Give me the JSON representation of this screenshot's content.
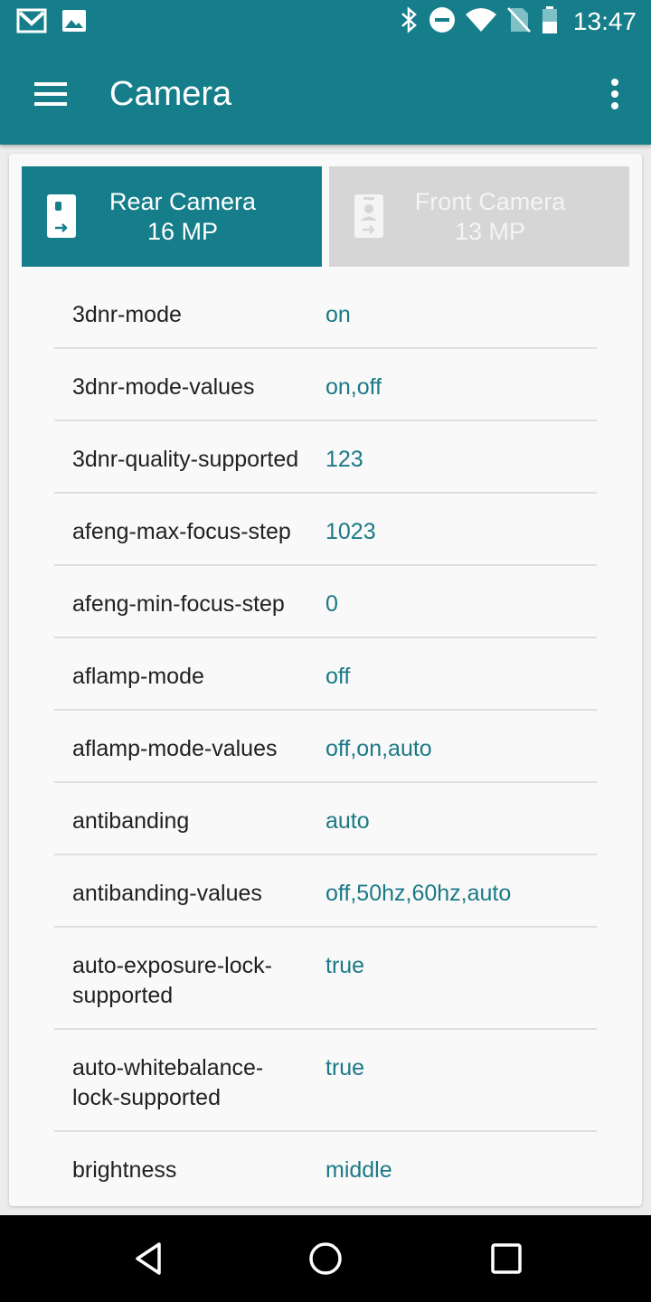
{
  "status_bar": {
    "time": "13:47",
    "left_icons": [
      "gmail-icon",
      "image-icon"
    ],
    "right_icons": [
      "bluetooth-icon",
      "do-not-disturb-icon",
      "wifi-icon",
      "no-sim-icon",
      "battery-icon"
    ]
  },
  "app_bar": {
    "title": "Camera",
    "menu_icon": "hamburger-menu-icon",
    "overflow_icon": "more-vert-icon"
  },
  "tabs": [
    {
      "label": "Rear Camera",
      "sub": "16 MP",
      "selected": true,
      "icon": "rear-camera-icon"
    },
    {
      "label": "Front Camera",
      "sub": "13 MP",
      "selected": false,
      "icon": "front-camera-icon"
    }
  ],
  "params": [
    {
      "key": "3dnr-mode",
      "value": "on"
    },
    {
      "key": "3dnr-mode-values",
      "value": "on,off"
    },
    {
      "key": "3dnr-quality-supported",
      "value": "123"
    },
    {
      "key": "afeng-max-focus-step",
      "value": "1023"
    },
    {
      "key": "afeng-min-focus-step",
      "value": "0"
    },
    {
      "key": "aflamp-mode",
      "value": "off"
    },
    {
      "key": "aflamp-mode-values",
      "value": "off,on,auto"
    },
    {
      "key": "antibanding",
      "value": "auto"
    },
    {
      "key": "antibanding-values",
      "value": "off,50hz,60hz,auto"
    },
    {
      "key": "auto-exposure-lock-supported",
      "value": "true"
    },
    {
      "key": "auto-whitebalance-lock-supported",
      "value": "true"
    },
    {
      "key": "brightness",
      "value": "middle"
    }
  ],
  "params_display": {
    "key_9_line1": "auto-exposure-lock-",
    "key_9_line2": "supported",
    "key_10_line1": "auto-whitebalance-",
    "key_10_line2": "lock-supported"
  },
  "colors": {
    "primary": "#167e8a",
    "value_text": "#1a7a86",
    "inactive_tab": "#d6d6d6"
  },
  "nav_bar": {
    "icons": [
      "back-icon",
      "home-icon",
      "recents-icon"
    ]
  }
}
